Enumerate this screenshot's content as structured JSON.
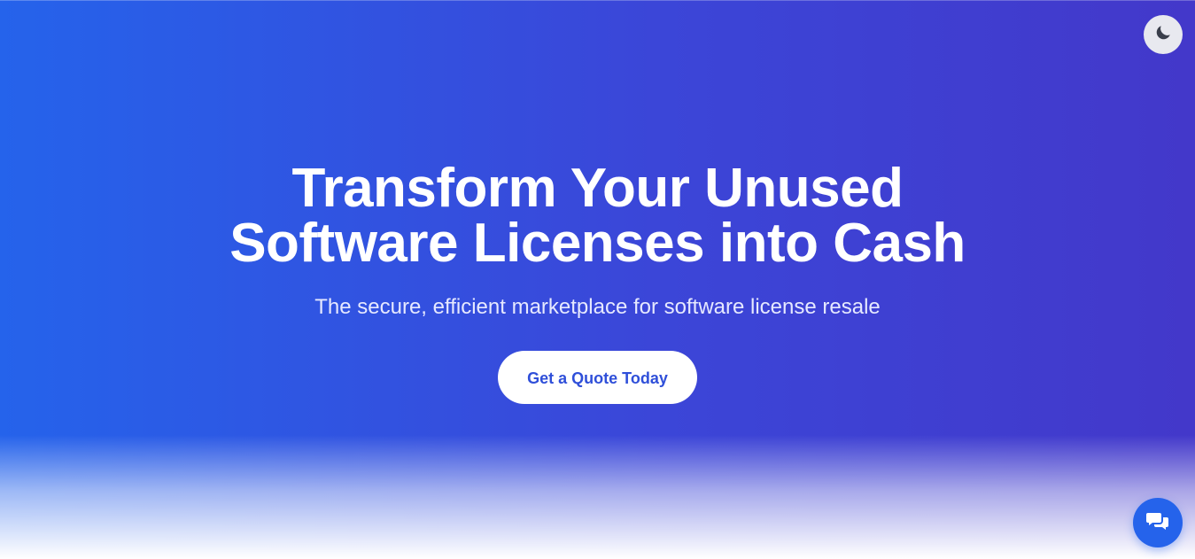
{
  "hero": {
    "title": "Transform Your Unused Software Licenses into Cash",
    "subtitle": "The secure, efficient marketplace for software license resale",
    "cta_label": "Get a Quote Today"
  },
  "controls": {
    "theme_toggle_icon": "moon-icon",
    "chat_icon": "chat-bubbles-icon"
  },
  "colors": {
    "gradient_start": "#2563eb",
    "gradient_end": "#4338ca",
    "cta_text": "#2f4fd9",
    "chat_button": "#2563eb"
  }
}
